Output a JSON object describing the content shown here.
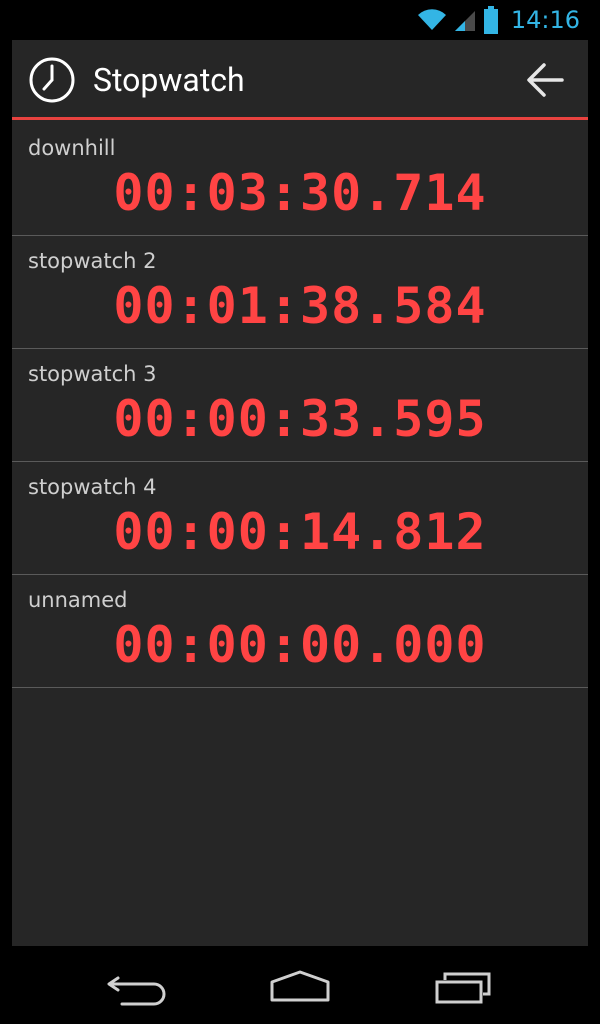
{
  "status_bar": {
    "time": "14:16",
    "icons": [
      "wifi-icon",
      "cell-signal-icon",
      "battery-icon"
    ],
    "accent_color": "#33b5e5"
  },
  "action_bar": {
    "title": "Stopwatch",
    "app_icon": "clock-icon",
    "back_icon": "back-arrow-icon",
    "underline_color": "#e8423f"
  },
  "stopwatches": [
    {
      "name": "downhill",
      "time": "00:03:30.714"
    },
    {
      "name": "stopwatch 2",
      "time": "00:01:38.584"
    },
    {
      "name": "stopwatch 3",
      "time": "00:00:33.595"
    },
    {
      "name": "stopwatch 4",
      "time": "00:00:14.812"
    },
    {
      "name": "unnamed",
      "time": "00:00:00.000"
    }
  ],
  "colors": {
    "time_text": "#ff4444",
    "background": "#262626"
  },
  "nav_bar": {
    "buttons": [
      "back-nav-icon",
      "home-nav-icon",
      "recents-nav-icon"
    ]
  }
}
